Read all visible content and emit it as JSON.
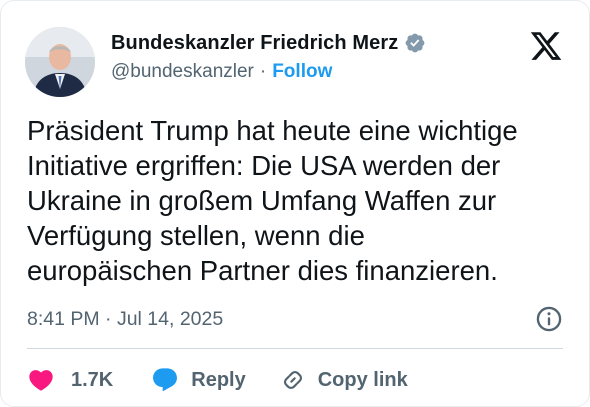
{
  "author": {
    "display_name": "Bundeskanzler Friedrich Merz",
    "handle": "@bundeskanzler",
    "separator": "·",
    "follow_label": "Follow",
    "verified_badge_color": "#829aab"
  },
  "tweet": {
    "text": "Präsident Trump hat heute eine wichtige\nInitiative ergriffen: Die USA werden der\nUkraine in großem Umfang Waffen zur\nVerfügung stellen, wenn die\neuropäischen Partner dies finanzieren.",
    "timestamp": "8:41 PM · Jul 14, 2025"
  },
  "actions": {
    "like_count": "1.7K",
    "reply_label": "Reply",
    "copy_link_label": "Copy link"
  },
  "colors": {
    "accent": "#1d9bf0",
    "like": "#f91880",
    "muted": "#536471",
    "text": "#0f1419"
  },
  "icons": {
    "brand": "x-logo-icon",
    "info": "info-icon",
    "like": "heart-icon",
    "reply": "reply-bubble-icon",
    "copy": "link-icon"
  }
}
